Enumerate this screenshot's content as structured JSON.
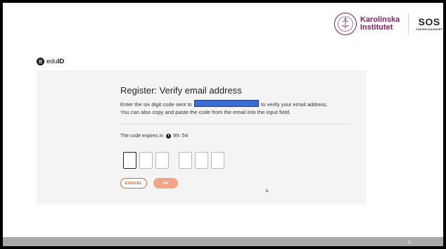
{
  "logos": {
    "karolinska_line1": "Karolinska",
    "karolinska_line2": "Institutet",
    "sos_mark": "SOS",
    "sos_sub": "SÖDERSJUKHUSET"
  },
  "brand": {
    "name_light": "edu",
    "name_bold": "ID"
  },
  "form": {
    "title": "Register: Verify email address",
    "instruction_before": "Enter the six digit code sent to",
    "instruction_after": "to verify your email address.",
    "instruction_line2": "You can also copy and paste the code from the email into the input field.",
    "expiry_label": "The code expires in",
    "timer": "09:54",
    "code_digits": [
      "",
      "",
      "",
      "",
      "",
      ""
    ],
    "cancel_label": "CANCEL",
    "ok_label": "OK"
  },
  "footer": {
    "page_number": "8"
  },
  "colors": {
    "accent": "#d2622c",
    "ok_disabled": "#f2a487",
    "redaction": "#3a6fd1",
    "ki_purple": "#7a1e63"
  }
}
